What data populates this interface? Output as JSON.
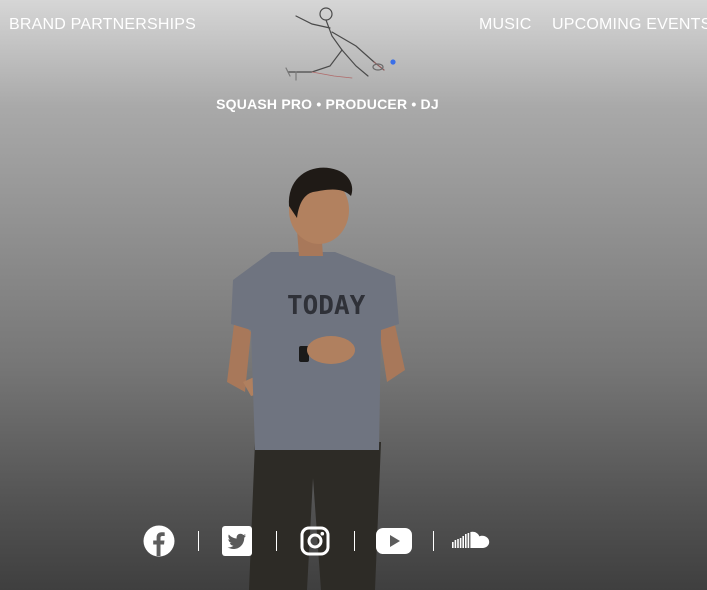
{
  "nav": {
    "left": "BRAND PARTNERSHIPS",
    "music": "MUSIC",
    "events": "UPCOMING EVENTS"
  },
  "hero": {
    "tagline": "SQUASH PRO • PRODUCER • DJ",
    "shirt_text": "TODAY"
  },
  "social": {
    "icons": [
      "facebook-icon",
      "twitter-icon",
      "instagram-icon",
      "youtube-icon",
      "soundcloud-icon"
    ]
  },
  "colors": {
    "text": "#ffffff",
    "logo_dot": "#3a6fe8"
  }
}
